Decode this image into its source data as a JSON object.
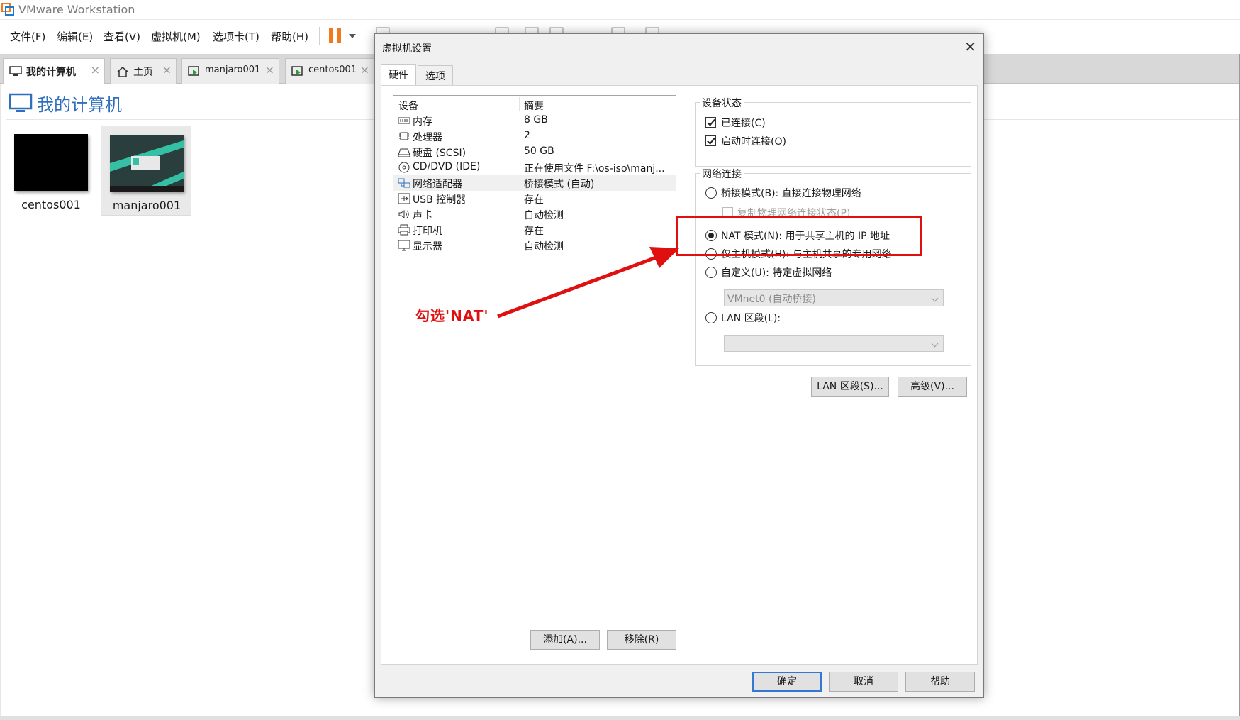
{
  "app": {
    "title": "VMware Workstation"
  },
  "menubar": {
    "items": [
      "文件(F)",
      "编辑(E)",
      "查看(V)",
      "虚拟机(M)",
      "选项卡(T)",
      "帮助(H)"
    ]
  },
  "tabs": [
    {
      "label": "我的计算机",
      "icon": "computer-icon",
      "active": true
    },
    {
      "label": "主页",
      "icon": "home-icon",
      "active": false
    },
    {
      "label": "manjaro001",
      "icon": "vm-running-icon",
      "active": false
    },
    {
      "label": "centos001",
      "icon": "vm-running-icon",
      "active": false
    }
  ],
  "page": {
    "heading": "我的计算机",
    "vms": [
      {
        "name": "centos001",
        "selected": false
      },
      {
        "name": "manjaro001",
        "selected": true
      }
    ]
  },
  "dialog": {
    "title": "虚拟机设置",
    "tabs": [
      "硬件",
      "选项"
    ],
    "device_columns": {
      "device": "设备",
      "summary": "摘要"
    },
    "devices": [
      {
        "name": "内存",
        "summary": "8 GB",
        "icon": "memory-icon"
      },
      {
        "name": "处理器",
        "summary": "2",
        "icon": "cpu-icon"
      },
      {
        "name": "硬盘 (SCSI)",
        "summary": "50 GB",
        "icon": "hard-disk-icon"
      },
      {
        "name": "CD/DVD (IDE)",
        "summary": "正在使用文件 F:\\os-iso\\manj...",
        "icon": "cd-dvd-icon"
      },
      {
        "name": "网络适配器",
        "summary": "桥接模式 (自动)",
        "icon": "network-adapter-icon",
        "selected": true
      },
      {
        "name": "USB 控制器",
        "summary": "存在",
        "icon": "usb-icon"
      },
      {
        "name": "声卡",
        "summary": "自动检测",
        "icon": "speaker-icon"
      },
      {
        "name": "打印机",
        "summary": "存在",
        "icon": "printer-icon"
      },
      {
        "name": "显示器",
        "summary": "自动检测",
        "icon": "monitor-icon"
      }
    ],
    "device_status": {
      "title": "设备状态",
      "connected": {
        "label": "已连接(C)",
        "checked": true
      },
      "connect_at_power_on": {
        "label": "启动时连接(O)",
        "checked": true
      }
    },
    "network": {
      "title": "网络连接",
      "bridged": {
        "label": "桥接模式(B): 直接连接物理网络",
        "checked": false
      },
      "replicate": {
        "label": "复制物理网络连接状态(P)",
        "checked": false,
        "disabled": true
      },
      "nat": {
        "label": "NAT 模式(N): 用于共享主机的 IP 地址",
        "checked": true
      },
      "host_only": {
        "label": "仅主机模式(H): 与主机共享的专用网络",
        "checked": false
      },
      "custom": {
        "label": "自定义(U): 特定虚拟网络",
        "checked": false
      },
      "custom_select": "VMnet0 (自动桥接)",
      "lan_segment": {
        "label": "LAN 区段(L):",
        "checked": false
      },
      "lan_select": ""
    },
    "buttons": {
      "lan_segments": "LAN 区段(S)...",
      "advanced": "高级(V)...",
      "add": "添加(A)...",
      "remove": "移除(R)",
      "ok": "确定",
      "cancel": "取消",
      "help": "帮助"
    }
  },
  "annotation": {
    "text": "勾选'NAT'",
    "color": "#e01010"
  }
}
